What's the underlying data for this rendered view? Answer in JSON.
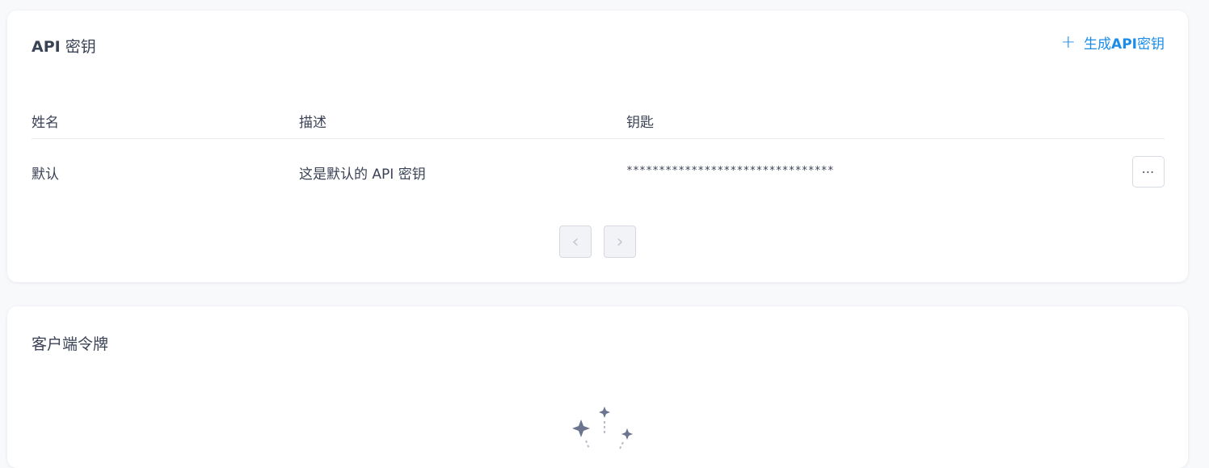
{
  "api_keys": {
    "title_bold": "API",
    "title_rest": " 密钥",
    "generate_label_pre": "生成",
    "generate_label_bold": "API",
    "generate_label_post": "密钥",
    "columns": {
      "name": "姓名",
      "description": "描述",
      "key": "钥匙"
    },
    "rows": [
      {
        "name": "默认",
        "description": "这是默认的 API 密钥",
        "key": "********************************"
      }
    ],
    "more_label": "⋯",
    "pager": {
      "prev": "‹",
      "next": "›"
    }
  },
  "client_tokens": {
    "title": "客户端令牌"
  },
  "icons": {
    "generate": "plus-icon",
    "more": "more-horizontal-icon",
    "prev": "chevron-left-icon",
    "next": "chevron-right-icon",
    "empty": "sparkles-illustration"
  },
  "colors": {
    "accent": "#1b8ce8",
    "text": "#3b4256",
    "border": "#e8eaef"
  }
}
